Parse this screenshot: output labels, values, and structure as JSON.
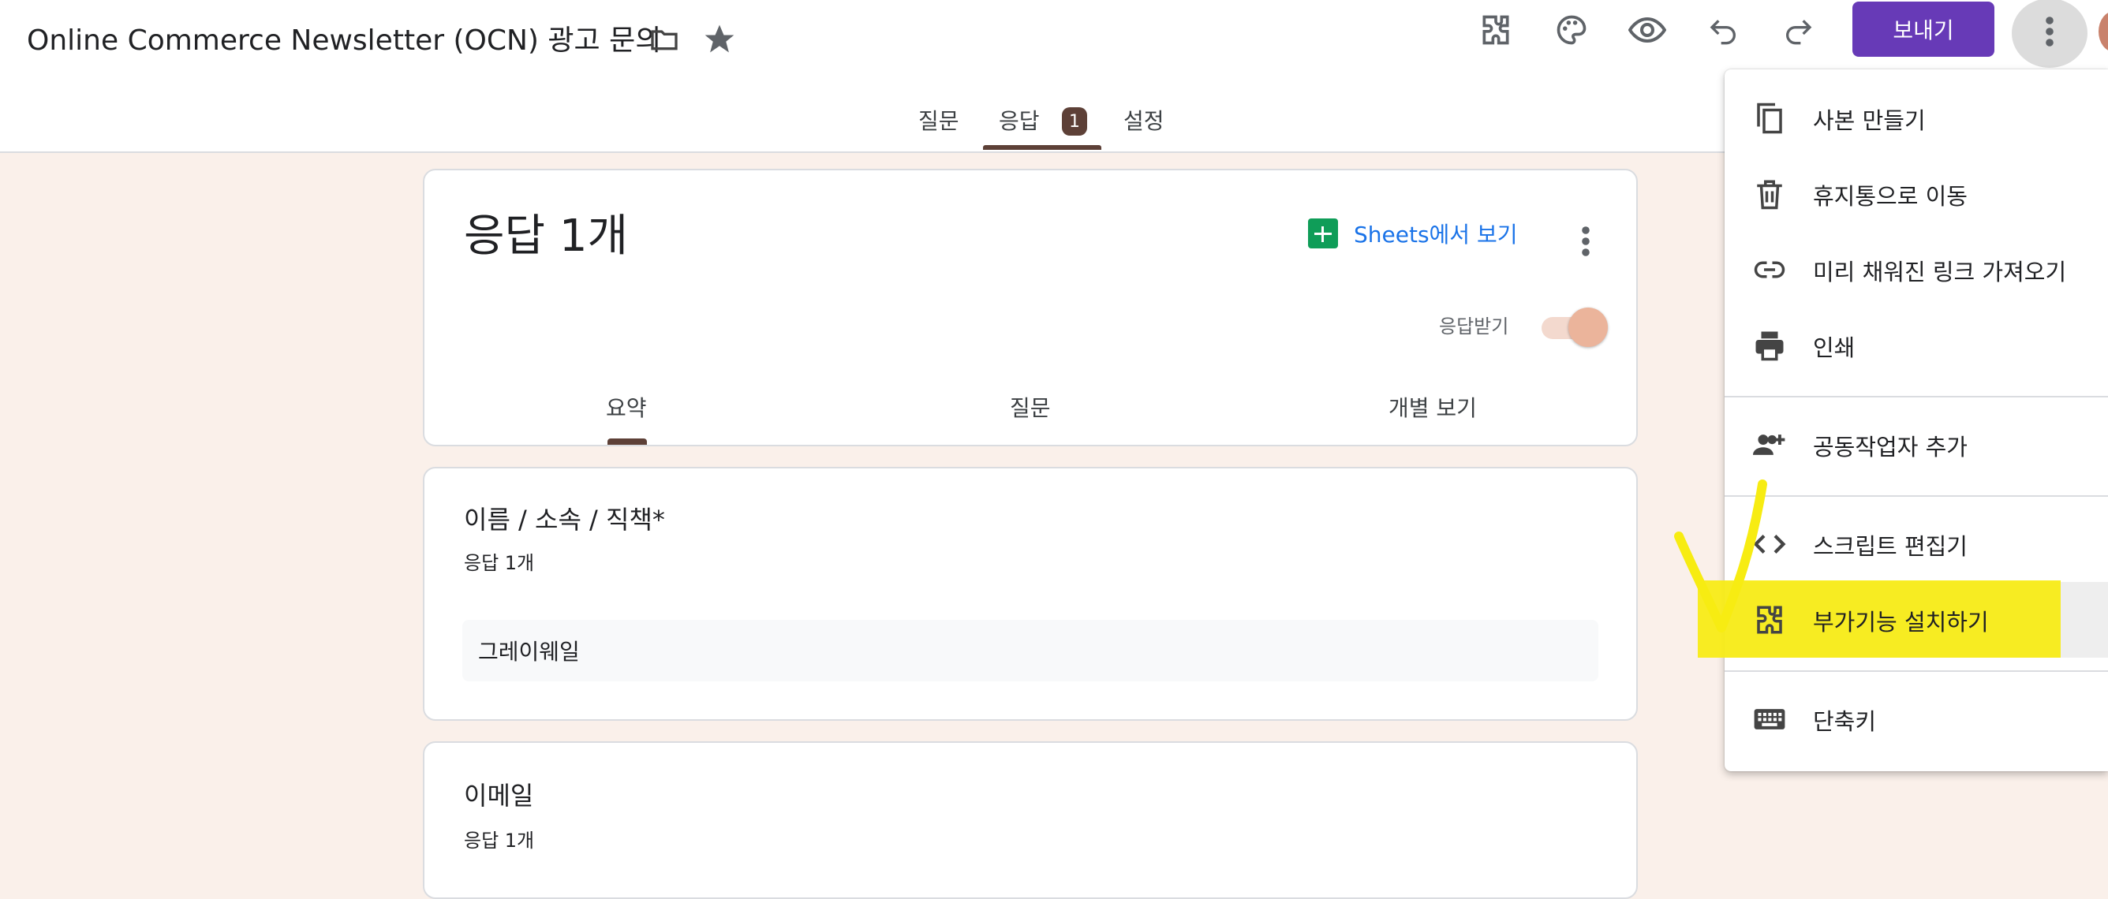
{
  "document": {
    "title": "Online Commerce Newsletter (OCN) 광고 문의"
  },
  "toolbar": {
    "icons": [
      "addons-icon",
      "palette-icon",
      "preview-eye-icon",
      "undo-icon",
      "redo-icon",
      "more-vert-icon"
    ],
    "send_label": "보내기"
  },
  "main_tabs": [
    {
      "label": "질문"
    },
    {
      "label": "응답",
      "badge": "1",
      "active": true
    },
    {
      "label": "설정"
    }
  ],
  "responses_card": {
    "title": "응답 1개",
    "sheets_link": "Sheets에서 보기",
    "accepting_label": "응답받기",
    "accepting": true,
    "subtabs": [
      {
        "label": "요약",
        "active": true
      },
      {
        "label": "질문"
      },
      {
        "label": "개별 보기"
      }
    ]
  },
  "questions": [
    {
      "title": "이름 / 소속 / 직책*",
      "count": "응답 1개",
      "answer": "그레이웨일"
    },
    {
      "title": "이메일",
      "count": "응답 1개"
    }
  ],
  "menu": {
    "items": [
      {
        "label": "사본 만들기",
        "icon": "copy-icon"
      },
      {
        "label": "휴지통으로 이동",
        "icon": "trash-icon"
      },
      {
        "label": "미리 채워진 링크 가져오기",
        "icon": "link-icon"
      },
      {
        "label": "인쇄",
        "icon": "print-icon"
      },
      {
        "label": "공동작업자 추가",
        "icon": "add-people-icon"
      },
      {
        "label": "스크립트 편집기",
        "icon": "code-icon"
      },
      {
        "label": "부가기능 설치하기",
        "icon": "puzzle-icon"
      },
      {
        "label": "단축키",
        "icon": "keyboard-icon"
      }
    ]
  },
  "colors": {
    "accent": "#673ab7",
    "theme_brown": "#5d4037",
    "page_bg": "#faf0ea",
    "highlight": "#f7ec12"
  }
}
